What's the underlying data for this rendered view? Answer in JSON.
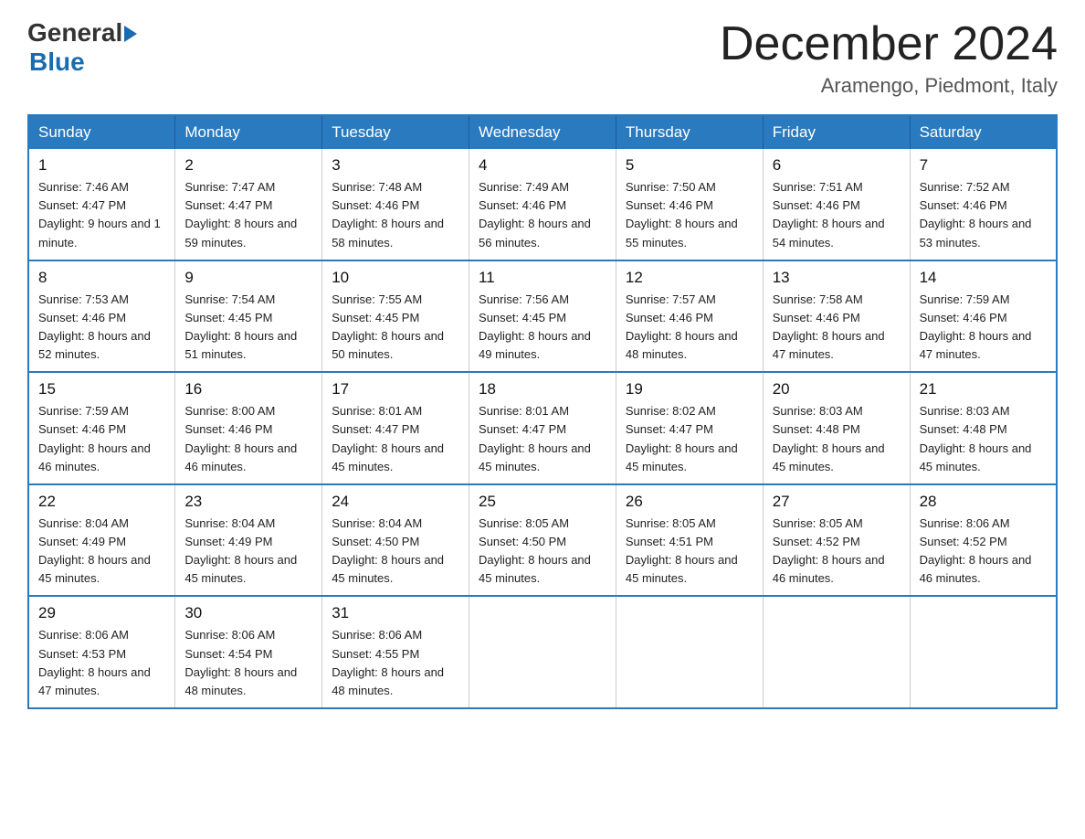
{
  "header": {
    "logo_general": "General",
    "logo_blue": "Blue",
    "month_title": "December 2024",
    "subtitle": "Aramengo, Piedmont, Italy"
  },
  "weekdays": [
    "Sunday",
    "Monday",
    "Tuesday",
    "Wednesday",
    "Thursday",
    "Friday",
    "Saturday"
  ],
  "weeks": [
    [
      {
        "day": "1",
        "sunrise": "7:46 AM",
        "sunset": "4:47 PM",
        "daylight": "9 hours and 1 minute."
      },
      {
        "day": "2",
        "sunrise": "7:47 AM",
        "sunset": "4:47 PM",
        "daylight": "8 hours and 59 minutes."
      },
      {
        "day": "3",
        "sunrise": "7:48 AM",
        "sunset": "4:46 PM",
        "daylight": "8 hours and 58 minutes."
      },
      {
        "day": "4",
        "sunrise": "7:49 AM",
        "sunset": "4:46 PM",
        "daylight": "8 hours and 56 minutes."
      },
      {
        "day": "5",
        "sunrise": "7:50 AM",
        "sunset": "4:46 PM",
        "daylight": "8 hours and 55 minutes."
      },
      {
        "day": "6",
        "sunrise": "7:51 AM",
        "sunset": "4:46 PM",
        "daylight": "8 hours and 54 minutes."
      },
      {
        "day": "7",
        "sunrise": "7:52 AM",
        "sunset": "4:46 PM",
        "daylight": "8 hours and 53 minutes."
      }
    ],
    [
      {
        "day": "8",
        "sunrise": "7:53 AM",
        "sunset": "4:46 PM",
        "daylight": "8 hours and 52 minutes."
      },
      {
        "day": "9",
        "sunrise": "7:54 AM",
        "sunset": "4:45 PM",
        "daylight": "8 hours and 51 minutes."
      },
      {
        "day": "10",
        "sunrise": "7:55 AM",
        "sunset": "4:45 PM",
        "daylight": "8 hours and 50 minutes."
      },
      {
        "day": "11",
        "sunrise": "7:56 AM",
        "sunset": "4:45 PM",
        "daylight": "8 hours and 49 minutes."
      },
      {
        "day": "12",
        "sunrise": "7:57 AM",
        "sunset": "4:46 PM",
        "daylight": "8 hours and 48 minutes."
      },
      {
        "day": "13",
        "sunrise": "7:58 AM",
        "sunset": "4:46 PM",
        "daylight": "8 hours and 47 minutes."
      },
      {
        "day": "14",
        "sunrise": "7:59 AM",
        "sunset": "4:46 PM",
        "daylight": "8 hours and 47 minutes."
      }
    ],
    [
      {
        "day": "15",
        "sunrise": "7:59 AM",
        "sunset": "4:46 PM",
        "daylight": "8 hours and 46 minutes."
      },
      {
        "day": "16",
        "sunrise": "8:00 AM",
        "sunset": "4:46 PM",
        "daylight": "8 hours and 46 minutes."
      },
      {
        "day": "17",
        "sunrise": "8:01 AM",
        "sunset": "4:47 PM",
        "daylight": "8 hours and 45 minutes."
      },
      {
        "day": "18",
        "sunrise": "8:01 AM",
        "sunset": "4:47 PM",
        "daylight": "8 hours and 45 minutes."
      },
      {
        "day": "19",
        "sunrise": "8:02 AM",
        "sunset": "4:47 PM",
        "daylight": "8 hours and 45 minutes."
      },
      {
        "day": "20",
        "sunrise": "8:03 AM",
        "sunset": "4:48 PM",
        "daylight": "8 hours and 45 minutes."
      },
      {
        "day": "21",
        "sunrise": "8:03 AM",
        "sunset": "4:48 PM",
        "daylight": "8 hours and 45 minutes."
      }
    ],
    [
      {
        "day": "22",
        "sunrise": "8:04 AM",
        "sunset": "4:49 PM",
        "daylight": "8 hours and 45 minutes."
      },
      {
        "day": "23",
        "sunrise": "8:04 AM",
        "sunset": "4:49 PM",
        "daylight": "8 hours and 45 minutes."
      },
      {
        "day": "24",
        "sunrise": "8:04 AM",
        "sunset": "4:50 PM",
        "daylight": "8 hours and 45 minutes."
      },
      {
        "day": "25",
        "sunrise": "8:05 AM",
        "sunset": "4:50 PM",
        "daylight": "8 hours and 45 minutes."
      },
      {
        "day": "26",
        "sunrise": "8:05 AM",
        "sunset": "4:51 PM",
        "daylight": "8 hours and 45 minutes."
      },
      {
        "day": "27",
        "sunrise": "8:05 AM",
        "sunset": "4:52 PM",
        "daylight": "8 hours and 46 minutes."
      },
      {
        "day": "28",
        "sunrise": "8:06 AM",
        "sunset": "4:52 PM",
        "daylight": "8 hours and 46 minutes."
      }
    ],
    [
      {
        "day": "29",
        "sunrise": "8:06 AM",
        "sunset": "4:53 PM",
        "daylight": "8 hours and 47 minutes."
      },
      {
        "day": "30",
        "sunrise": "8:06 AM",
        "sunset": "4:54 PM",
        "daylight": "8 hours and 48 minutes."
      },
      {
        "day": "31",
        "sunrise": "8:06 AM",
        "sunset": "4:55 PM",
        "daylight": "8 hours and 48 minutes."
      },
      null,
      null,
      null,
      null
    ]
  ]
}
